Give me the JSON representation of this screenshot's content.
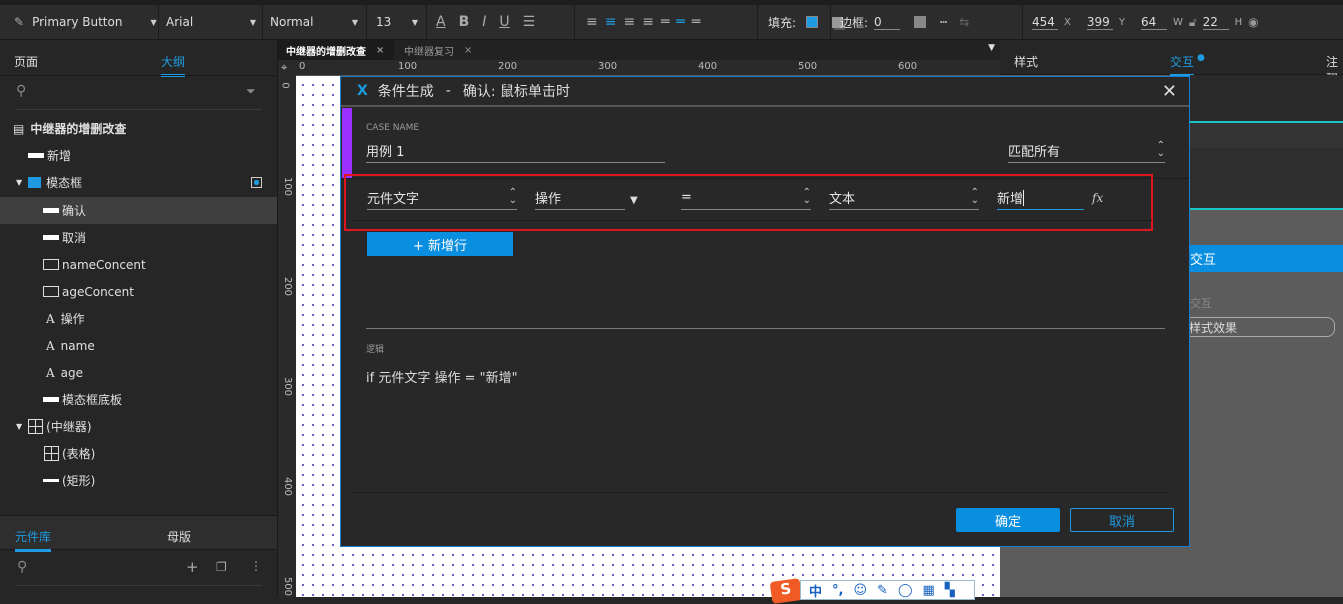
{
  "toolbar": {
    "style": "Primary Button",
    "font": "Arial",
    "weight": "Normal",
    "size": "13",
    "fill_label": "填充:",
    "border_label": "边框:",
    "border_value": "0",
    "x": "454",
    "x_label": "X",
    "y": "399",
    "y_label": "Y",
    "w": "64",
    "w_label": "W",
    "h": "22",
    "h_label": "H",
    "fill_color": "#1e9be0"
  },
  "left": {
    "tabs": [
      "页面",
      "大纲"
    ],
    "active_tab": "大纲",
    "page_title": "中继器的增删改查",
    "items": [
      {
        "label": "新增",
        "icon": "button-icon"
      },
      {
        "label": "模态框",
        "icon": "folder-icon"
      },
      {
        "label": "确认",
        "icon": "button-icon"
      },
      {
        "label": "取消",
        "icon": "button-icon"
      },
      {
        "label": "nameConcent",
        "icon": "textbox-icon"
      },
      {
        "label": "ageConcent",
        "icon": "textbox-icon"
      },
      {
        "label": "操作",
        "icon": "text-icon"
      },
      {
        "label": "name",
        "icon": "text-icon"
      },
      {
        "label": "age",
        "icon": "text-icon"
      },
      {
        "label": "模态框底板",
        "icon": "button-icon"
      },
      {
        "label": "(中继器)",
        "icon": "repeater-icon"
      },
      {
        "label": "(表格)",
        "icon": "table-icon"
      },
      {
        "label": "(矩形)",
        "icon": "rectangle-icon"
      }
    ],
    "bottom_tabs": [
      "元件库",
      "母版"
    ]
  },
  "doc_tabs": [
    "中继器的增删改查",
    "中继器复习"
  ],
  "ruler": {
    "h": [
      "0",
      "100",
      "200",
      "300",
      "400",
      "500",
      "600"
    ],
    "v": [
      "0",
      "100",
      "200",
      "300",
      "400",
      "500"
    ]
  },
  "right": {
    "tabs": [
      "样式",
      "交互",
      "注释"
    ],
    "active_tab": "交互",
    "interaction_header": "交互",
    "interaction_sub": "交互",
    "style_effect": "样式效果"
  },
  "dialog": {
    "title": "条件生成",
    "separator": "-",
    "subtitle": "确认: 鼠标单击时",
    "case_name_label": "CASE NAME",
    "case_name": "用例 1",
    "match": "匹配所有",
    "condition": {
      "target_type": "元件文字",
      "target": "操作",
      "operator": "=",
      "value_type": "文本",
      "value": "新增",
      "fx": "fx"
    },
    "add_row": "+ 新增行",
    "logic_label": "逻辑",
    "logic": "if 元件文字 操作 = \"新增\"",
    "ok": "确定",
    "cancel": "取消"
  },
  "ime": {
    "items": [
      "中",
      "°,",
      "☺",
      "✎",
      "◯",
      "▦",
      "▚"
    ]
  }
}
